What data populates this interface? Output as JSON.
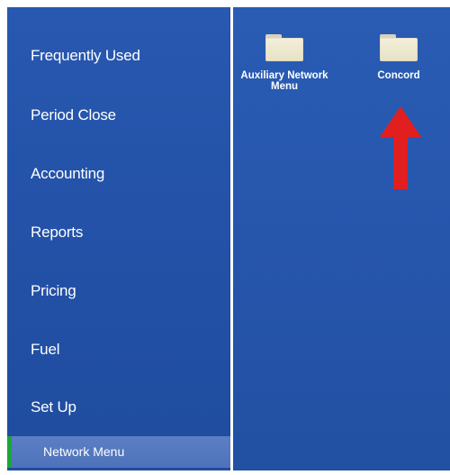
{
  "sidebar": {
    "items": [
      {
        "label": "Frequently Used"
      },
      {
        "label": "Period Close"
      },
      {
        "label": "Accounting"
      },
      {
        "label": "Reports"
      },
      {
        "label": "Pricing"
      },
      {
        "label": "Fuel"
      },
      {
        "label": "Set Up"
      }
    ],
    "selected_sub_item": {
      "label": "Network Menu"
    }
  },
  "main": {
    "tiles": [
      {
        "label": "Auxiliary Network Menu",
        "icon": "folder-icon"
      },
      {
        "label": "Concord",
        "icon": "folder-icon"
      }
    ]
  },
  "annotation": {
    "icon": "red-arrow-icon",
    "color": "#e11f1f"
  },
  "colors": {
    "sidebar_bg": "#2352a8",
    "main_bg": "#2656ac",
    "selected_bg": "#5577bf",
    "selected_accent": "#1aa63a"
  }
}
